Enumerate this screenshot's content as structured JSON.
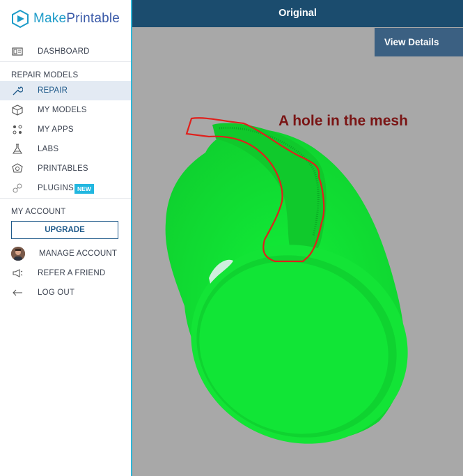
{
  "brand": {
    "name_part1": "Make",
    "name_part2": "Printable"
  },
  "sidebar": {
    "dashboard": "DASHBOARD",
    "repair_section": "REPAIR MODELS",
    "items": [
      {
        "label": "REPAIR",
        "icon": "wrench-icon",
        "active": true
      },
      {
        "label": "MY MODELS",
        "icon": "cube-icon"
      },
      {
        "label": "MY APPS",
        "icon": "apps-dots-icon"
      },
      {
        "label": "LABS",
        "icon": "flask-icon"
      },
      {
        "label": "PRINTABLES",
        "icon": "printables-icon"
      },
      {
        "label": "PLUGINS",
        "icon": "plugin-icon",
        "badge": "NEW"
      }
    ],
    "account_section": "MY ACCOUNT",
    "upgrade_label": "UPGRADE",
    "account_items": [
      {
        "label": "MANAGE ACCOUNT",
        "icon": "avatar"
      },
      {
        "label": "REFER A FRIEND",
        "icon": "megaphone-icon"
      },
      {
        "label": "LOG OUT",
        "icon": "arrow-left-icon"
      }
    ]
  },
  "main": {
    "title": "Original",
    "view_details_label": "View Details",
    "annotation": "A hole in the mesh"
  },
  "colors": {
    "accent": "#2fb6d8",
    "topbar": "#1b4c6e",
    "model": "#1aff3a",
    "highlight": "#e0201c"
  }
}
